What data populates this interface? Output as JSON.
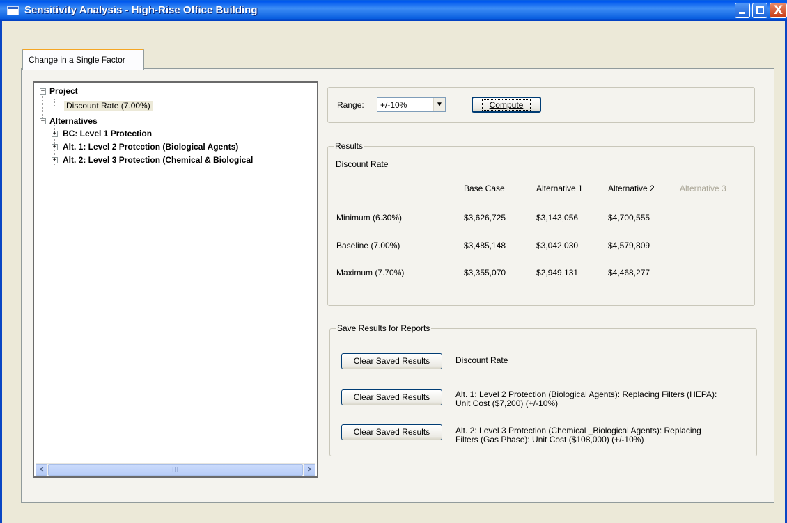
{
  "window": {
    "title": "Sensitivity Analysis - High-Rise Office Building",
    "close_glyph": "X"
  },
  "tabs": [
    {
      "label": "Change in a Single Factor",
      "active": true
    }
  ],
  "tree": {
    "project": {
      "label": "Project",
      "expander": "−",
      "children": [
        "Discount Rate (7.00%)"
      ]
    },
    "alternatives": {
      "label": "Alternatives",
      "expander": "−",
      "children": [
        {
          "label": "BC: Level 1 Protection",
          "expander": "+"
        },
        {
          "label": "Alt. 1: Level 2 Protection (Biological Agents)",
          "expander": "+"
        },
        {
          "label": "Alt. 2: Level 3 Protection (Chemical & Biological",
          "expander": "+"
        }
      ]
    },
    "scrollbar": {
      "left": "<",
      "right": ">",
      "grip": "III"
    }
  },
  "range": {
    "label": "Range:",
    "value": "+/-10%",
    "arrow": "▼",
    "compute_label": "Compute"
  },
  "results": {
    "legend": "Results",
    "factor": "Discount Rate",
    "columns": [
      "Base Case",
      "Alternative 1",
      "Alternative 2",
      "Alternative 3"
    ],
    "rows": [
      {
        "label": "Minimum  (6.30%)",
        "values": [
          "$3,626,725",
          "$3,143,056",
          "$4,700,555"
        ]
      },
      {
        "label": "Baseline  (7.00%)",
        "values": [
          "$3,485,148",
          "$3,042,030",
          "$4,579,809"
        ]
      },
      {
        "label": "Maximum  (7.70%)",
        "values": [
          "$3,355,070",
          "$2,949,131",
          "$4,468,277"
        ]
      }
    ]
  },
  "saved": {
    "legend": "Save Results for Reports",
    "button_label": "Clear Saved Results",
    "items": [
      {
        "line1": "Discount Rate",
        "line2": ""
      },
      {
        "line1": "Alt. 1: Level 2 Protection (Biological Agents): Replacing Filters (HEPA):",
        "line2": "Unit Cost ($7,200) (+/-10%)"
      },
      {
        "line1": "Alt. 2: Level 3 Protection (Chemical _Biological Agents): Replacing",
        "line2": "Filters (Gas Phase): Unit Cost ($108,000) (+/-10%)"
      }
    ]
  },
  "colors": {
    "titlebar": "#0058ee",
    "window_bg": "#ece9d8",
    "panel_bg": "#f4f3ee",
    "tab_highlight": "#f5a623",
    "disabled_text": "#aca899"
  }
}
